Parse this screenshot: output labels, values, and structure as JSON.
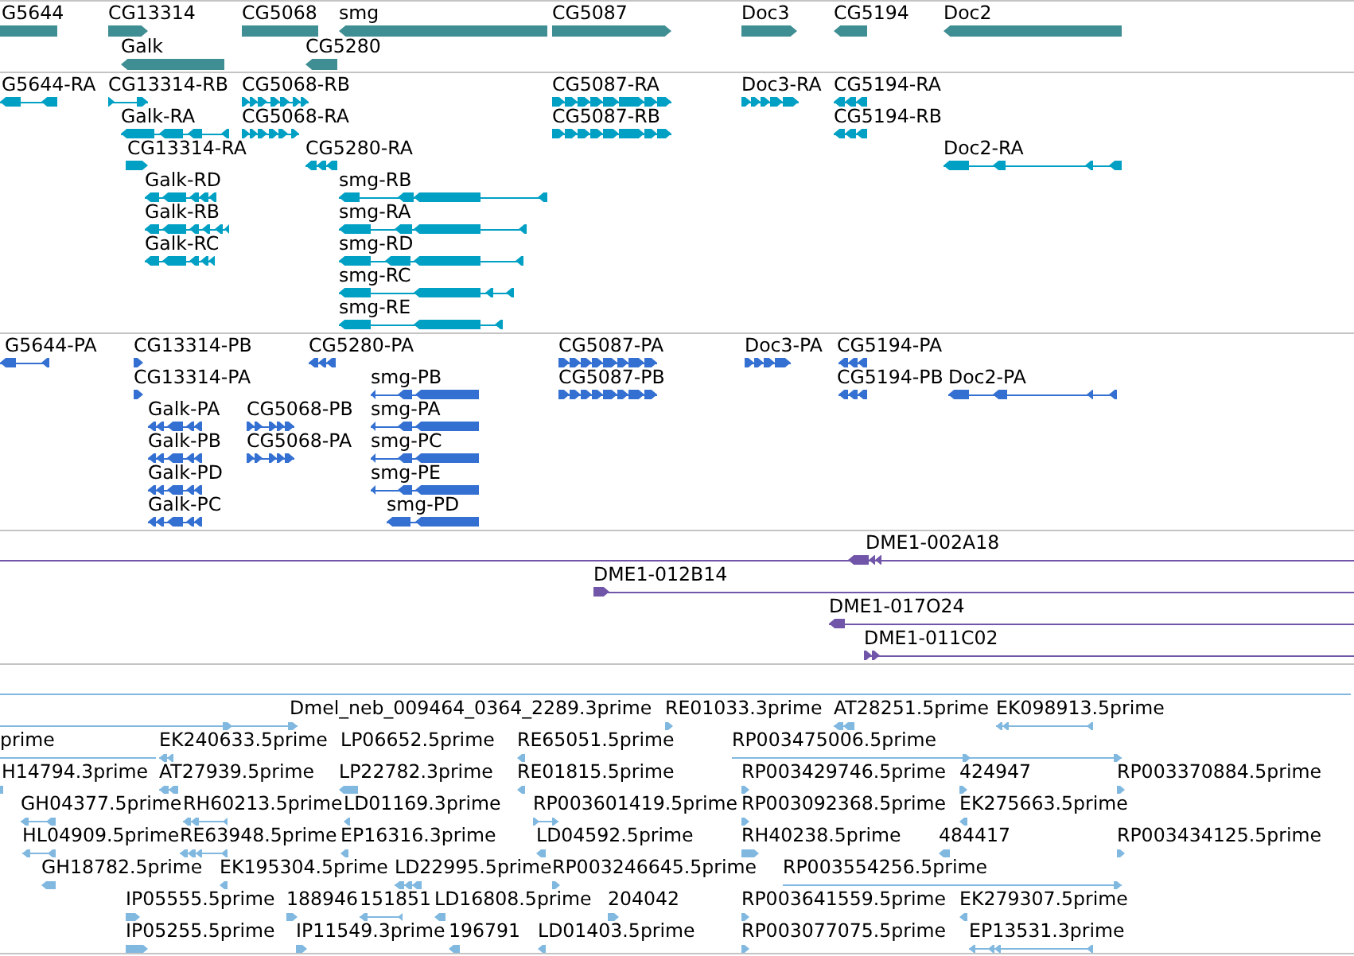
{
  "tracks": [
    {
      "kind": "gene",
      "features": [
        {
          "label": "G5644",
          "arrow_left": false,
          "arrow_right": false
        },
        {
          "label": "CG13314",
          "arrow_left": false,
          "arrow_right": true
        },
        {
          "label": "CG5068",
          "arrow_left": false,
          "arrow_right": false
        },
        {
          "label": "smg",
          "arrow_left": true,
          "arrow_right": false
        },
        {
          "label": "CG5087",
          "arrow_left": false,
          "arrow_right": true
        },
        {
          "label": "Doc3",
          "arrow_left": false,
          "arrow_right": true
        },
        {
          "label": "CG5194",
          "arrow_left": true,
          "arrow_right": false
        },
        {
          "label": "Doc2",
          "arrow_left": true,
          "arrow_right": false
        },
        {
          "label": "Galk",
          "arrow_left": true,
          "arrow_right": false
        },
        {
          "label": "CG5280",
          "arrow_left": true,
          "arrow_right": false
        }
      ]
    },
    {
      "kind": "transcript",
      "features": [
        {
          "label": "G5644-RA",
          "arrow_left": true,
          "arrow_right": false
        },
        {
          "label": "CG13314-RB",
          "arrow_left": false,
          "arrow_right": true
        },
        {
          "label": "CG5068-RB",
          "arrow_left": false,
          "arrow_right": true
        },
        {
          "label": "CG5087-RA",
          "arrow_left": false,
          "arrow_right": true
        },
        {
          "label": "Doc3-RA",
          "arrow_left": false,
          "arrow_right": true
        },
        {
          "label": "CG5194-RA",
          "arrow_left": true,
          "arrow_right": false
        },
        {
          "label": "Galk-RA",
          "arrow_left": true,
          "arrow_right": false
        },
        {
          "label": "CG5068-RA",
          "arrow_left": false,
          "arrow_right": true
        },
        {
          "label": "CG5087-RB",
          "arrow_left": false,
          "arrow_right": true
        },
        {
          "label": "CG5194-RB",
          "arrow_left": true,
          "arrow_right": false
        },
        {
          "label": "CG13314-RA",
          "arrow_left": false,
          "arrow_right": true
        },
        {
          "label": "CG5280-RA",
          "arrow_left": true,
          "arrow_right": false
        },
        {
          "label": "Doc2-RA",
          "arrow_left": true,
          "arrow_right": false
        },
        {
          "label": "Galk-RD",
          "arrow_left": true,
          "arrow_right": false
        },
        {
          "label": "smg-RB",
          "arrow_left": true,
          "arrow_right": false
        },
        {
          "label": "Galk-RB",
          "arrow_left": true,
          "arrow_right": false
        },
        {
          "label": "smg-RA",
          "arrow_left": true,
          "arrow_right": false
        },
        {
          "label": "Galk-RC",
          "arrow_left": true,
          "arrow_right": false
        },
        {
          "label": "smg-RD",
          "arrow_left": true,
          "arrow_right": false
        },
        {
          "label": "smg-RC",
          "arrow_left": true,
          "arrow_right": false
        },
        {
          "label": "smg-RE",
          "arrow_left": true,
          "arrow_right": false
        }
      ]
    },
    {
      "kind": "protein",
      "features": [
        {
          "label": "G5644-PA",
          "arrow_left": true,
          "arrow_right": false
        },
        {
          "label": "CG13314-PB",
          "arrow_left": false,
          "arrow_right": true
        },
        {
          "label": "CG5280-PA",
          "arrow_left": true,
          "arrow_right": false
        },
        {
          "label": "CG5087-PA",
          "arrow_left": false,
          "arrow_right": true
        },
        {
          "label": "Doc3-PA",
          "arrow_left": false,
          "arrow_right": true
        },
        {
          "label": "CG5194-PA",
          "arrow_left": true,
          "arrow_right": false
        },
        {
          "label": "CG13314-PA",
          "arrow_left": false,
          "arrow_right": true
        },
        {
          "label": "smg-PB",
          "arrow_left": true,
          "arrow_right": false
        },
        {
          "label": "CG5087-PB",
          "arrow_left": false,
          "arrow_right": true
        },
        {
          "label": "CG5194-PB",
          "arrow_left": true,
          "arrow_right": false
        },
        {
          "label": "Doc2-PA",
          "arrow_left": true,
          "arrow_right": false
        },
        {
          "label": "Galk-PA",
          "arrow_left": true,
          "arrow_right": false
        },
        {
          "label": "CG5068-PB",
          "arrow_left": false,
          "arrow_right": true
        },
        {
          "label": "smg-PA",
          "arrow_left": true,
          "arrow_right": false
        },
        {
          "label": "Galk-PB",
          "arrow_left": true,
          "arrow_right": false
        },
        {
          "label": "CG5068-PA",
          "arrow_left": false,
          "arrow_right": true
        },
        {
          "label": "smg-PC",
          "arrow_left": true,
          "arrow_right": false
        },
        {
          "label": "Galk-PD",
          "arrow_left": true,
          "arrow_right": false
        },
        {
          "label": "smg-PE",
          "arrow_left": true,
          "arrow_right": false
        },
        {
          "label": "Galk-PC",
          "arrow_left": true,
          "arrow_right": false
        },
        {
          "label": "smg-PD",
          "arrow_left": true,
          "arrow_right": false
        }
      ]
    },
    {
      "kind": "clone",
      "features": [
        {
          "label": "DME1-002A18",
          "arrow_left": true,
          "arrow_right": false
        },
        {
          "label": "DME1-012B14",
          "arrow_left": false,
          "arrow_right": true
        },
        {
          "label": "DME1-017O24",
          "arrow_left": true,
          "arrow_right": false
        },
        {
          "label": "DME1-011C02",
          "arrow_left": false,
          "arrow_right": true
        }
      ]
    },
    {
      "kind": "est",
      "features": [
        {
          "arrow_left": false,
          "arrow_right": false
        },
        {
          "label": "Dmel_neb_009464_0364_2289.3prime",
          "arrow_left": false,
          "arrow_right": true
        },
        {
          "label": "RE01033.3prime",
          "arrow_left": false,
          "arrow_right": true
        },
        {
          "label": "AT28251.5prime",
          "arrow_left": true,
          "arrow_right": false
        },
        {
          "label": "EK098913.5prime",
          "arrow_left": true,
          "arrow_right": false
        },
        {
          "label": "prime",
          "arrow_left": false,
          "arrow_right": false
        },
        {
          "label": "EK240633.5prime",
          "arrow_left": true,
          "arrow_right": false
        },
        {
          "label": "LP06652.5prime"
        },
        {
          "label": "RE65051.5prime",
          "arrow_left": true,
          "arrow_right": false
        },
        {
          "label": "RP003475006.5prime",
          "arrow_left": false,
          "arrow_right": true
        },
        {
          "label": "H14794.3prime",
          "arrow_left": false,
          "arrow_right": false
        },
        {
          "label": "AT27939.5prime",
          "arrow_left": true,
          "arrow_right": false
        },
        {
          "label": "LP22782.3prime",
          "arrow_left": true,
          "arrow_right": false
        },
        {
          "label": "RE01815.5prime",
          "arrow_left": true,
          "arrow_right": false
        },
        {
          "label": "RP003429746.5prime",
          "arrow_left": false,
          "arrow_right": true
        },
        {
          "label": "424947",
          "arrow_left": false,
          "arrow_right": true
        },
        {
          "label": "RP003370884.5prime",
          "arrow_left": false,
          "arrow_right": true
        },
        {
          "label": "GH04377.5prime",
          "arrow_left": true,
          "arrow_right": false
        },
        {
          "label": "RH60213.5prime",
          "arrow_left": true,
          "arrow_right": false
        },
        {
          "label": "LD01169.3prime",
          "arrow_left": true,
          "arrow_right": false
        },
        {
          "label": "RP003601419.5prime",
          "arrow_left": false,
          "arrow_right": true
        },
        {
          "label": "RP003092368.5prime",
          "arrow_left": false,
          "arrow_right": true
        },
        {
          "label": "EK275663.5prime",
          "arrow_left": true,
          "arrow_right": false
        },
        {
          "label": "HL04909.5prime",
          "arrow_left": true,
          "arrow_right": false
        },
        {
          "label": "RE63948.5prime",
          "arrow_left": true,
          "arrow_right": false
        },
        {
          "label": "EP16316.3prime",
          "arrow_left": true,
          "arrow_right": false
        },
        {
          "label": "LD04592.5prime",
          "arrow_left": true,
          "arrow_right": false
        },
        {
          "label": "RH40238.5prime",
          "arrow_left": false,
          "arrow_right": true
        },
        {
          "label": "484417",
          "arrow_left": true,
          "arrow_right": false
        },
        {
          "label": "RP003434125.5prime",
          "arrow_left": false,
          "arrow_right": true
        },
        {
          "label": "GH18782.5prime",
          "arrow_left": true,
          "arrow_right": false
        },
        {
          "label": "EK195304.5prime",
          "arrow_left": true,
          "arrow_right": false
        },
        {
          "label": "LD22995.5prime",
          "arrow_left": true,
          "arrow_right": false
        },
        {
          "label": "RP003246645.5prime",
          "arrow_left": false,
          "arrow_right": true
        },
        {
          "label": "RP003554256.5prime",
          "arrow_left": false,
          "arrow_right": true
        },
        {
          "label": "IP05555.5prime",
          "arrow_left": false,
          "arrow_right": true
        },
        {
          "label": "188946",
          "arrow_left": false,
          "arrow_right": true
        },
        {
          "label": "151851",
          "arrow_left": true,
          "arrow_right": false
        },
        {
          "label": "LD16808.5prime",
          "arrow_left": true,
          "arrow_right": false
        },
        {
          "label": "204042",
          "arrow_left": false,
          "arrow_right": true
        },
        {
          "label": "RP003641559.5prime",
          "arrow_left": false,
          "arrow_right": true
        },
        {
          "label": "EK279307.5prime",
          "arrow_left": true,
          "arrow_right": false
        },
        {
          "label": "IP05255.5prime",
          "arrow_left": false,
          "arrow_right": true
        },
        {
          "label": "IP11549.3prime",
          "arrow_left": false,
          "arrow_right": true
        },
        {
          "label": "196791",
          "arrow_left": true,
          "arrow_right": false
        },
        {
          "label": "LD01403.5prime",
          "arrow_left": true,
          "arrow_right": false
        },
        {
          "label": "RP003077075.5prime",
          "arrow_left": false,
          "arrow_right": true
        },
        {
          "label": "EP13531.3prime",
          "arrow_left": true,
          "arrow_right": false
        }
      ]
    }
  ]
}
